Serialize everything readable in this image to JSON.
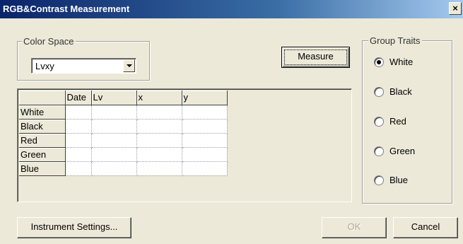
{
  "window": {
    "title": "RGB&Contrast Measurement",
    "close_glyph": "×"
  },
  "color_space": {
    "legend": "Color Space",
    "selected": "Lvxy"
  },
  "buttons": {
    "measure": "Measure",
    "instrument_settings": "Instrument Settings...",
    "ok": "OK",
    "cancel": "Cancel"
  },
  "table": {
    "columns": [
      "Date",
      "Lv",
      "x",
      "y"
    ],
    "rows": [
      "White",
      "Black",
      "Red",
      "Green",
      "Blue"
    ]
  },
  "group_traits": {
    "legend": "Group Traits",
    "options": [
      "White",
      "Black",
      "Red",
      "Green",
      "Blue"
    ],
    "selected": "White"
  }
}
